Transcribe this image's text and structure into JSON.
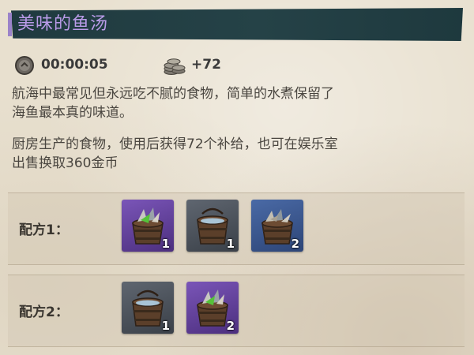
{
  "item": {
    "title": "美味的鱼汤"
  },
  "stats": {
    "time_icon": "clock-coin-icon",
    "time": "00:00:05",
    "supply_icon": "coin-stack-icon",
    "supply": "+72"
  },
  "description": {
    "line1": "航海中最常见但永远吃不腻的食物，简单的水煮保留了",
    "line2": "海鱼最本真的味道。",
    "line3": "厨房生产的食物，使用后获得72个补给，也可在娱乐室",
    "line4": "出售换取360金币"
  },
  "recipes": [
    {
      "label": "配方1：",
      "ingredients": [
        {
          "icon": "fish-bucket-green-icon",
          "rarity": "purple",
          "qty": "1"
        },
        {
          "icon": "water-bucket-icon",
          "rarity": "grey",
          "qty": "1"
        },
        {
          "icon": "fish-bucket-icon",
          "rarity": "blue",
          "qty": "2"
        }
      ]
    },
    {
      "label": "配方2：",
      "ingredients": [
        {
          "icon": "water-bucket-icon",
          "rarity": "grey",
          "qty": "1"
        },
        {
          "icon": "fish-bucket-green-icon",
          "rarity": "purple",
          "qty": "2"
        }
      ]
    }
  ],
  "colors": {
    "title_bar": "#234045",
    "title_text": "#b99be8",
    "purple_slot": "#6a48a6",
    "grey_slot": "#4d545d",
    "blue_slot": "#3c5a92"
  }
}
